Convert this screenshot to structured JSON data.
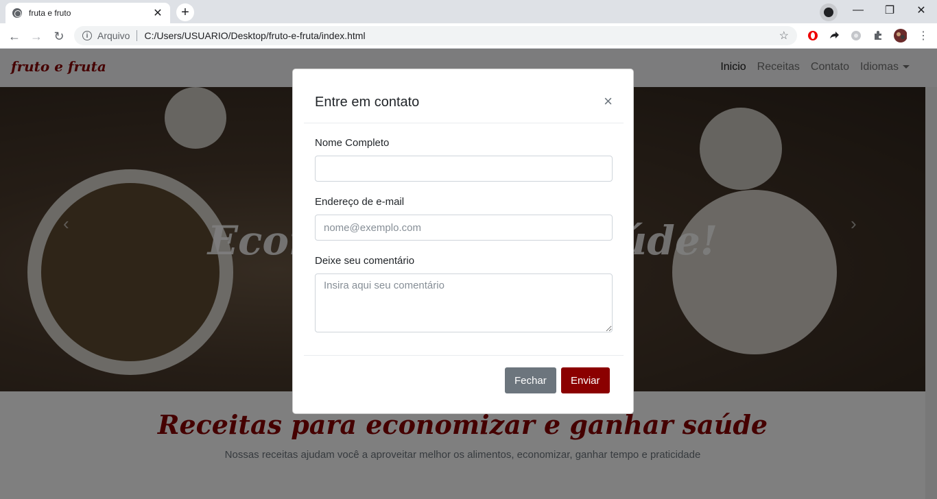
{
  "browser": {
    "tab_title": "fruta e fruto",
    "tab_close": "✕",
    "new_tab": "+",
    "window_controls": {
      "minimize": "—",
      "maximize": "❐",
      "close": "✕"
    },
    "omnibox_label": "Arquivo",
    "url": "C:/Users/USUARIO/Desktop/fruto-e-fruta/index.html",
    "nav_icons": {
      "back": "←",
      "forward": "→",
      "reload": "↻"
    },
    "star": "☆",
    "ext_icons": [
      "opera-icon",
      "share-icon",
      "extension-gray-icon",
      "puzzle-icon",
      "avatar-icon",
      "menu-dots-icon"
    ]
  },
  "site": {
    "brand": "fruto e fruta",
    "nav": [
      {
        "label": "Inicio",
        "active": true
      },
      {
        "label": "Receitas"
      },
      {
        "label": "Contato"
      },
      {
        "label": "Idiomas"
      }
    ],
    "hero_caption": "Economize com saúde!",
    "carousel_prev": "‹",
    "carousel_next": "›",
    "section_title": "Receitas para economizar e ganhar saúde",
    "section_subtitle": "Nossas receitas ajudam você a aproveitar melhor os alimentos, economizar, ganhar tempo e praticidade"
  },
  "modal": {
    "title": "Entre em contato",
    "close": "×",
    "name_label": "Nome Completo",
    "name_value": "",
    "email_label": "Endereço de e-mail",
    "email_placeholder": "nome@exemplo.com",
    "comment_label": "Deixe seu comentário",
    "comment_placeholder": "Insira aqui seu comentário",
    "close_button": "Fechar",
    "send_button": "Enviar"
  },
  "colors": {
    "brand": "#8b0000",
    "secondary_button": "#6c757d",
    "backdrop": "rgba(0,0,0,0.5)"
  }
}
